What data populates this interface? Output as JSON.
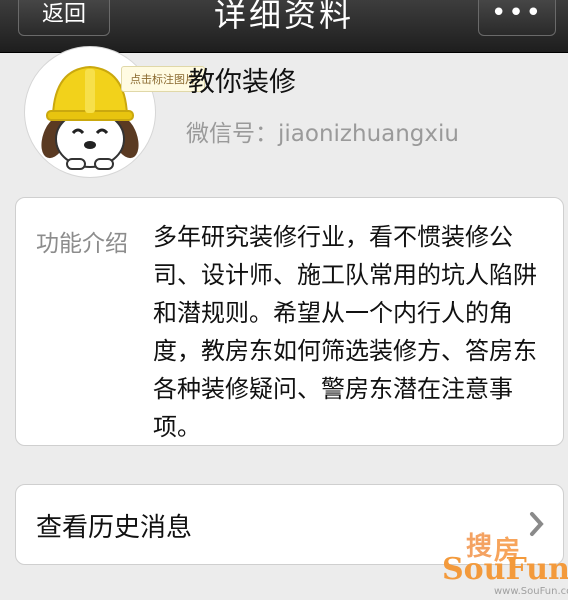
{
  "navbar": {
    "back_label": "返回",
    "title": "详细资料",
    "more_label": "•••"
  },
  "profile": {
    "avatar_tooltip": "点击标注图片",
    "name": "教你装修",
    "wechat_id": "微信号：jiaonizhuangxiu"
  },
  "intro": {
    "label": "功能介绍",
    "text": "多年研究装修行业，看不惯装修公司、设计师、施工队常用的坑人陷阱和潜规则。希望从一个内行人的角度，教房东如何筛选装修方、答房东各种装修疑问、警房东潜在注意事项。"
  },
  "history": {
    "label": "查看历史消息"
  },
  "watermark": {
    "sou": "搜",
    "fang": "房",
    "logo": "SouFun",
    "url": "www.SouFun.com"
  },
  "colors": {
    "navbar": "#2b2b2b",
    "background": "#ececec",
    "card": "#ffffff",
    "helmet": "#f2d21b",
    "watermark": "#f39a3c"
  }
}
